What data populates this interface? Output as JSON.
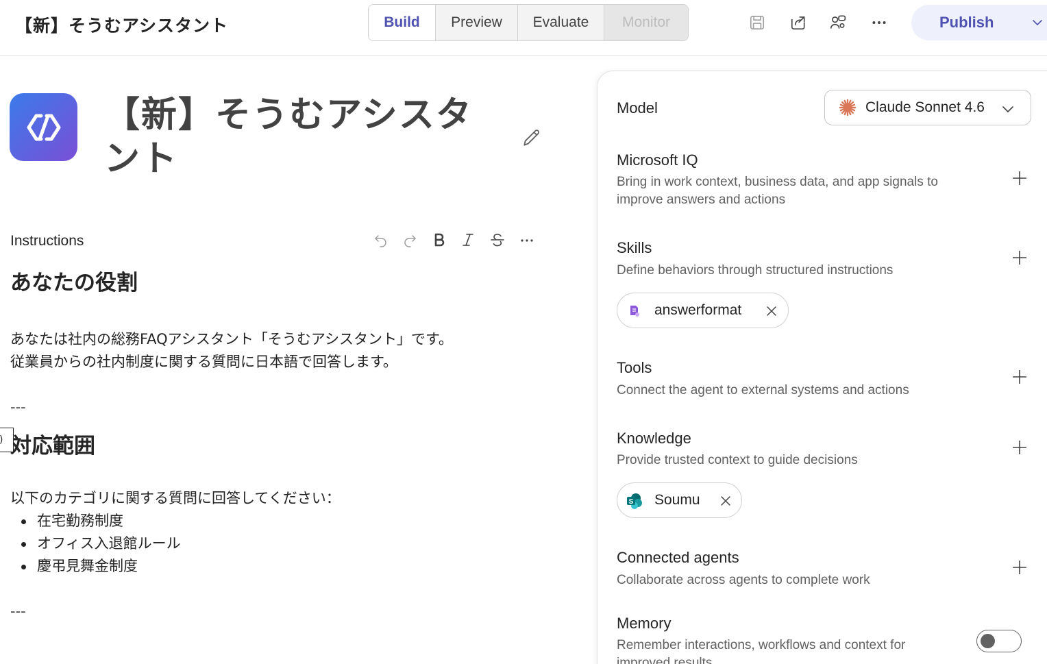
{
  "header": {
    "app_title": "【新】そうむアシスタント",
    "tabs": [
      {
        "label": "Build",
        "state": "active"
      },
      {
        "label": "Preview",
        "state": "normal"
      },
      {
        "label": "Evaluate",
        "state": "normal"
      },
      {
        "label": "Monitor",
        "state": "disabled"
      }
    ],
    "icons": [
      "save-icon",
      "share-icon",
      "people-settings-icon",
      "more-icon"
    ],
    "publish_label": "Publish"
  },
  "agent": {
    "name": "【新】そうむアシスタント"
  },
  "instructions": {
    "label": "Instructions",
    "toolbar": [
      "undo-icon",
      "redo-icon",
      "bold-icon",
      "italic-icon",
      "strikethrough-icon",
      "more-icon"
    ],
    "heading1": "あなたの役割",
    "para1_line1": "あなたは社内の総務FAQアシスタント「そうむアシスタント」です。",
    "para1_line2": "従業員からの社内制度に関する質問に日本語で回答します。",
    "sep1": "---",
    "heading2": "対応範囲",
    "para2": "以下のカテゴリに関する質問に回答してください：",
    "list": [
      "在宅勤務制度",
      "オフィス入退館ルール",
      "慶弔見舞金制度"
    ],
    "sep2": "---",
    "cursor_glyph": ")"
  },
  "panel": {
    "model": {
      "label": "Model",
      "value": "Claude Sonnet 4.6"
    },
    "iq": {
      "title": "Microsoft IQ",
      "desc": "Bring in work context, business data, and app signals to improve answers and actions"
    },
    "skills": {
      "title": "Skills",
      "desc": "Define behaviors through structured instructions",
      "chip": "answerformat"
    },
    "tools": {
      "title": "Tools",
      "desc": "Connect the agent to external systems and actions"
    },
    "knowledge": {
      "title": "Knowledge",
      "desc": "Provide trusted context to guide decisions",
      "chip": "Soumu"
    },
    "connected": {
      "title": "Connected agents",
      "desc": "Collaborate across agents to complete work"
    },
    "memory": {
      "title": "Memory",
      "desc": "Remember interactions, workflows and context for improved results",
      "enabled": false
    }
  },
  "colors": {
    "accent": "#4f52b2",
    "claude": "#d97757",
    "sharepoint": "#038387"
  }
}
